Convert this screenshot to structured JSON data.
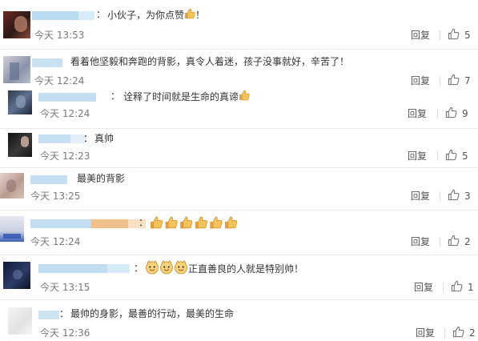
{
  "comments": [
    {
      "text": "小伙子，为你点赞",
      "time": "今天 13:53",
      "reply": "回复",
      "likes": "5",
      "emoji": "thumb",
      "emoji_count": 1,
      "after": "！"
    },
    {
      "text": "看着他坚毅和奔跑的背影，真令人着迷，孩子没事就好，辛苦了！",
      "time": "今天 12:24",
      "reply": "回复",
      "likes": "7"
    },
    {
      "text": "诠释了时间就是生命的真谛",
      "time": "今天 12:24",
      "reply": "回复",
      "likes": "9",
      "emoji": "thumb",
      "emoji_count": 1
    },
    {
      "text": "真帅",
      "time": "今天 12:23",
      "reply": "回复",
      "likes": "5"
    },
    {
      "text": "最美的背影",
      "time": "今天 13:25",
      "reply": "回复",
      "likes": "3"
    },
    {
      "text": "",
      "time": "今天 12:24",
      "reply": "回复",
      "likes": "2",
      "emoji": "thumb",
      "emoji_count": 6
    },
    {
      "text": "正直善良的人就是特别帅！",
      "time": "今天 13:15",
      "reply": "回复",
      "likes": "1",
      "emoji": "face",
      "emoji_count": 3
    },
    {
      "text": "最帅的身影，最善的行动，最美的生命",
      "time": "今天 12:36",
      "reply": "回复",
      "likes": "2"
    }
  ],
  "icons": {
    "like": "thumbs-up-icon",
    "emoji_thumb": "thumbs-up-emoji-icon",
    "emoji_face": "smiling-face-emoji-icon"
  },
  "colors": {
    "username_blur": "#a9d2ec",
    "time": "#7a7a7a",
    "emoji": "#f0b24a"
  }
}
